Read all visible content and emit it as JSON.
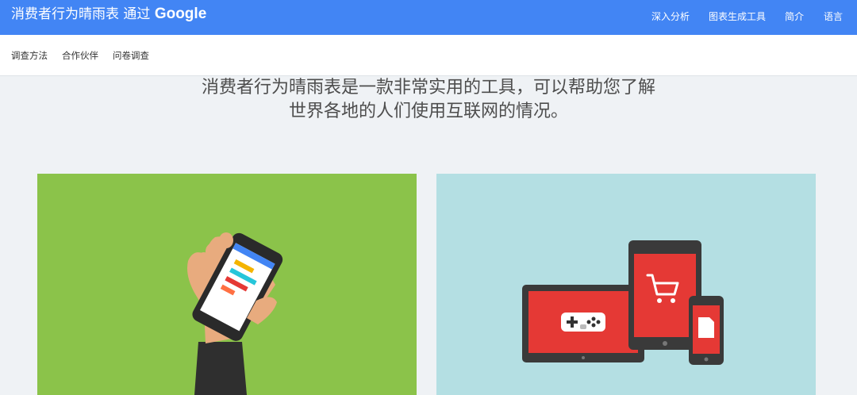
{
  "header": {
    "title": "消费者行为晴雨表 通过",
    "brand": "Google",
    "nav": [
      "深入分析",
      "图表生成工具",
      "简介",
      "语言"
    ]
  },
  "subnav": {
    "items": [
      "调查方法",
      "合作伙伴",
      "问卷调查"
    ]
  },
  "main": {
    "headline_line1": "消费者行为晴雨表是一款非常实用的工具，可以帮助您了解",
    "headline_line2": "世界各地的人们使用互联网的情况。"
  },
  "colors": {
    "header_bg": "#4285f4",
    "card_left_bg": "#8bc34a",
    "card_right_bg": "#b4dfe3",
    "device_red": "#e53935"
  }
}
